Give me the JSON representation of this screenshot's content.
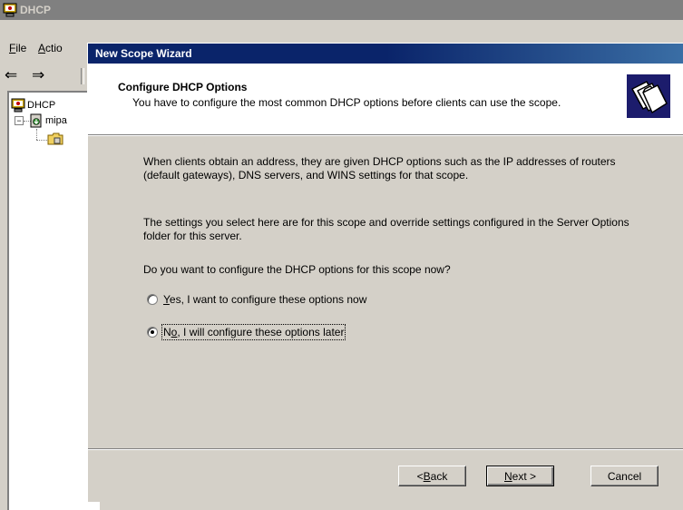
{
  "background_window": {
    "title": "DHCP",
    "menu": [
      {
        "accel": "F",
        "rest": "ile"
      },
      {
        "accel": "A",
        "rest": "ctio"
      }
    ],
    "tree": [
      {
        "label": "DHCP"
      },
      {
        "label": "mipa"
      }
    ]
  },
  "wizard": {
    "title": "New Scope Wizard",
    "header_title": "Configure DHCP Options",
    "header_subtitle": "You have to configure the most common DHCP options before clients can use the scope.",
    "paragraph1": "When clients obtain an address, they are given DHCP options such as the IP addresses of routers (default gateways), DNS servers, and WINS settings for that scope.",
    "paragraph2": "The settings you select here are for this scope and override settings configured in the Server Options folder for this server.",
    "question": "Do you want to configure the DHCP options for this scope now?",
    "options": [
      {
        "accel": "Y",
        "rest": "es, I want to configure these options now",
        "selected": false
      },
      {
        "pre": "N",
        "accel": "o",
        "rest": ", I will configure these options later",
        "selected": true
      }
    ],
    "buttons": {
      "back": {
        "pre": "< ",
        "accel": "B",
        "rest": "ack"
      },
      "next": {
        "accel": "N",
        "rest": "ext >"
      },
      "cancel": "Cancel"
    }
  }
}
